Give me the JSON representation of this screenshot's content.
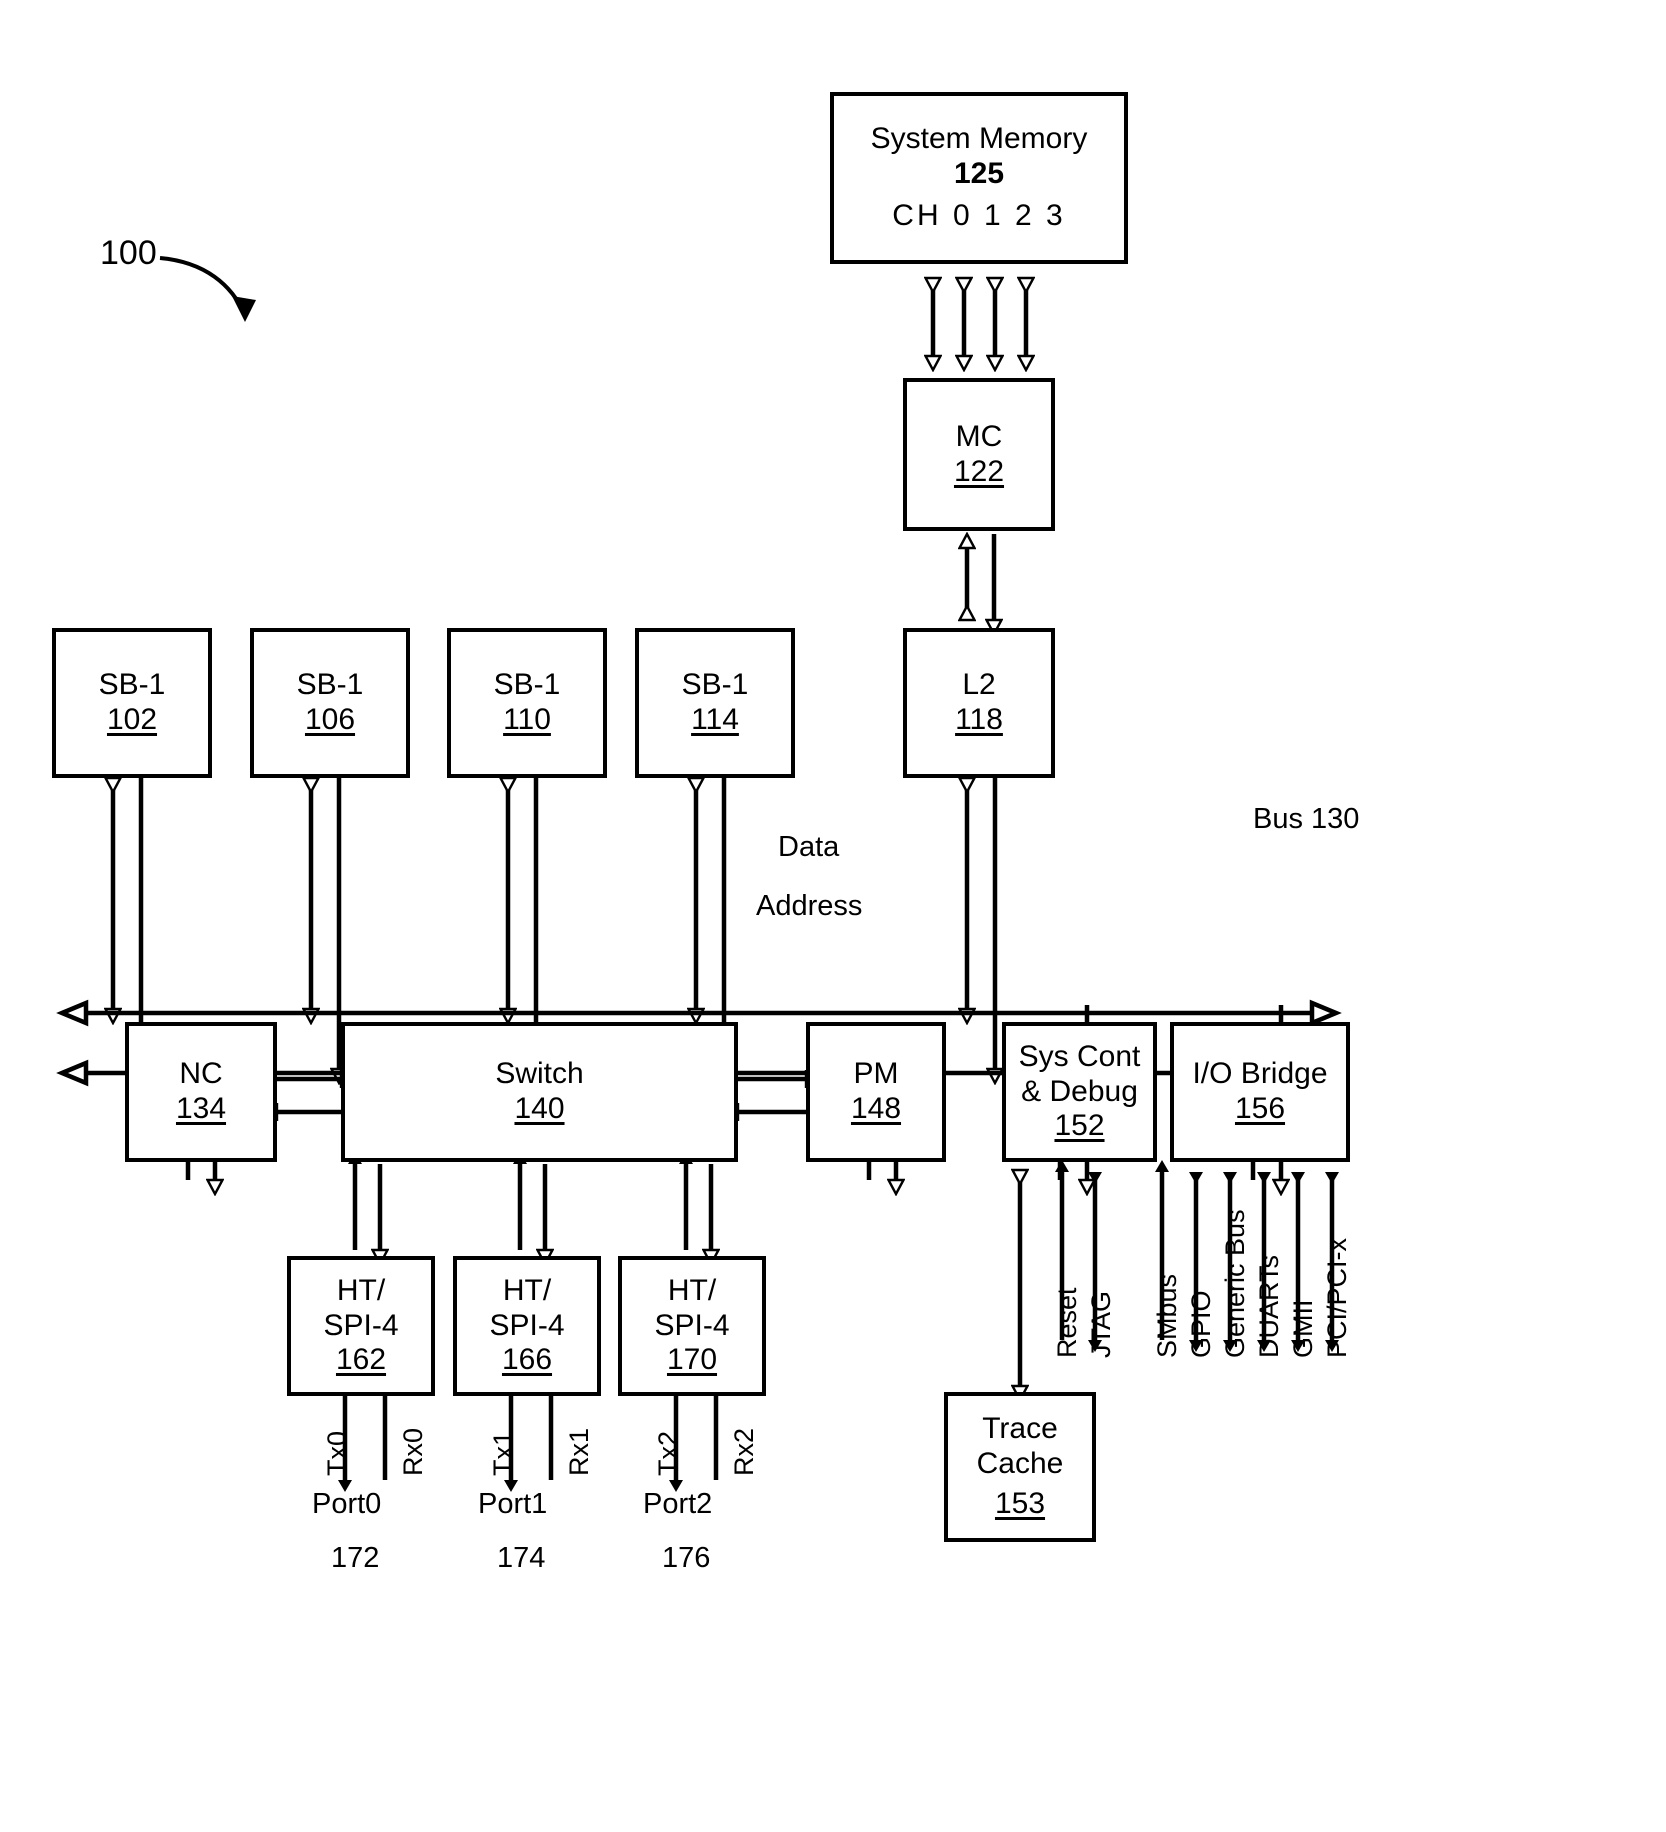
{
  "figure": {
    "ref_number": "100",
    "bus_label": "Bus 130",
    "data_label": "Data",
    "address_label": "Address"
  },
  "blocks": {
    "system_memory": {
      "title": "System Memory",
      "number": "125",
      "channels": "CH 0 1 2 3"
    },
    "mc": {
      "title": "MC",
      "number": "122"
    },
    "l2": {
      "title": "L2",
      "number": "118"
    },
    "sb1_a": {
      "title": "SB-1",
      "number": "102"
    },
    "sb1_b": {
      "title": "SB-1",
      "number": "106"
    },
    "sb1_c": {
      "title": "SB-1",
      "number": "110"
    },
    "sb1_d": {
      "title": "SB-1",
      "number": "114"
    },
    "nc": {
      "title": "NC",
      "number": "134"
    },
    "switch": {
      "title": "Switch",
      "number": "140"
    },
    "pm": {
      "title": "PM",
      "number": "148"
    },
    "syscont": {
      "line1": "Sys Cont",
      "line2": "& Debug",
      "number": "152"
    },
    "iobridge": {
      "title": "I/O Bridge",
      "number": "156"
    },
    "trace": {
      "line1": "Trace",
      "line2": "Cache",
      "number": "153"
    },
    "ht0": {
      "line1": "HT/",
      "line2": "SPI-4",
      "number": "162"
    },
    "ht1": {
      "line1": "HT/",
      "line2": "SPI-4",
      "number": "166"
    },
    "ht2": {
      "line1": "HT/",
      "line2": "SPI-4",
      "number": "170"
    }
  },
  "ports": [
    {
      "tx": "Tx0",
      "rx": "Rx0",
      "name": "Port0",
      "number": "172"
    },
    {
      "tx": "Tx1",
      "rx": "Rx1",
      "name": "Port1",
      "number": "174"
    },
    {
      "tx": "Tx2",
      "rx": "Rx2",
      "name": "Port2",
      "number": "176"
    }
  ],
  "syscont_signals": [
    "Reset",
    "JTAG"
  ],
  "iobridge_signals": [
    "SMbus",
    "GPIO",
    "Generic Bus",
    "DUARTs",
    "GMII",
    "PCI/PCI-x"
  ],
  "colors": {
    "stroke": "#000000",
    "background": "#ffffff"
  }
}
